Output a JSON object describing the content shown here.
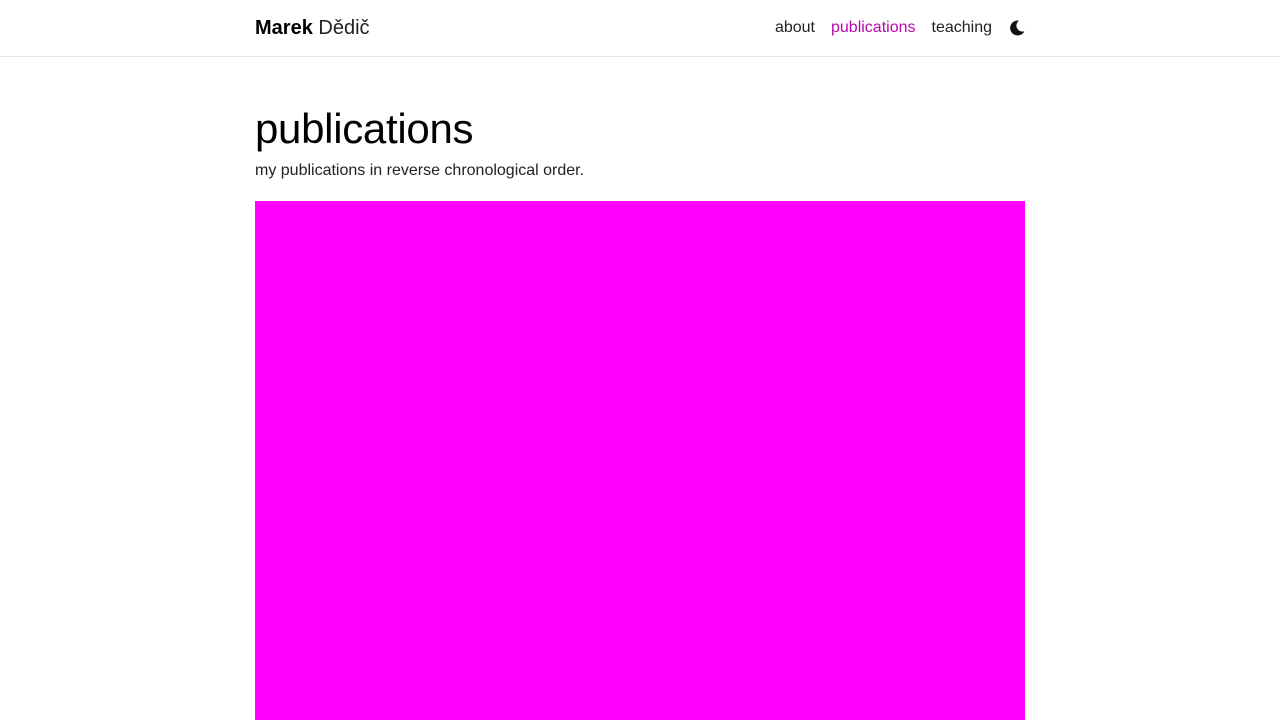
{
  "navbar": {
    "brand_first": "Marek",
    "brand_last": "Dědič",
    "links": [
      {
        "label": "about",
        "active": false
      },
      {
        "label": "publications",
        "active": true
      },
      {
        "label": "teaching",
        "active": false
      }
    ],
    "theme_toggle_icon": "moon-icon"
  },
  "page": {
    "title": "publications",
    "description": "my publications in reverse chronological order."
  },
  "colors": {
    "accent": "#b509ac",
    "hero_block": "#ff00ff"
  }
}
